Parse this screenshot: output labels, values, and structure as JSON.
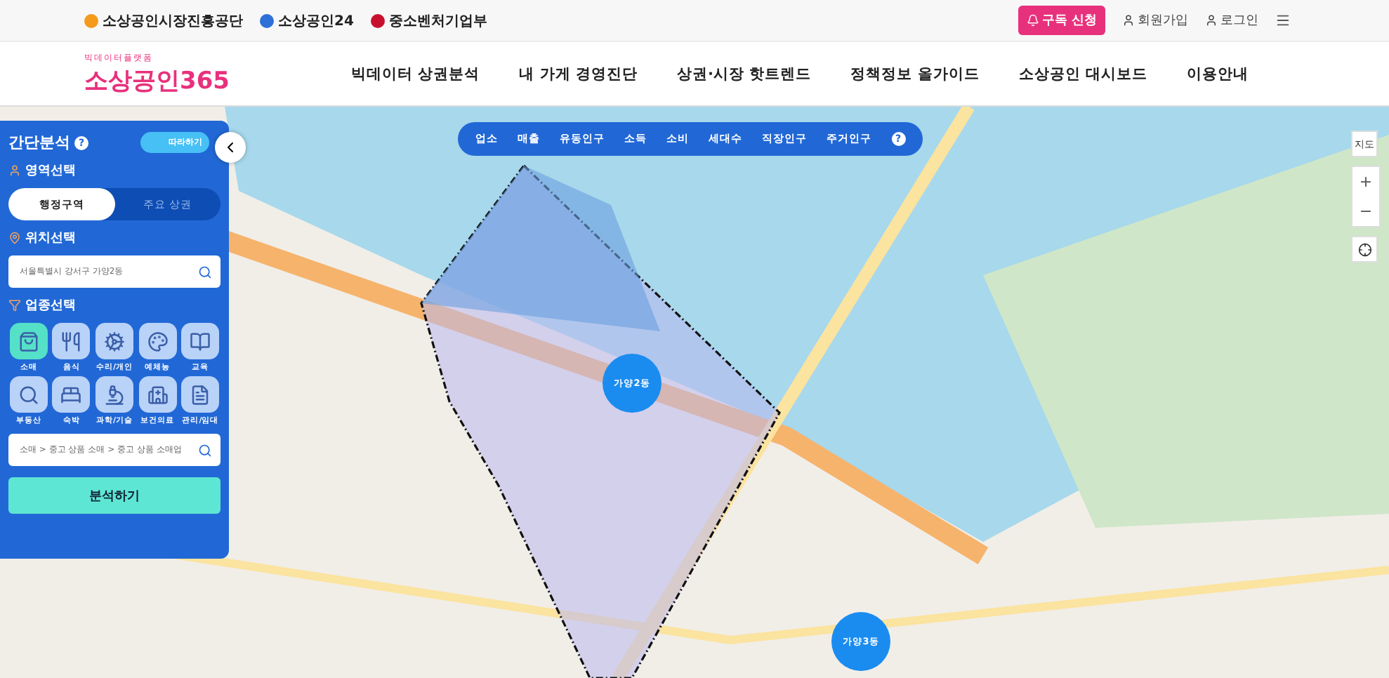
{
  "top_bar": {
    "agencies": [
      "소상공인시장진흥공단",
      "소상공인24",
      "중소벤처기업부"
    ],
    "subscribe_button": "구독 신청",
    "links": [
      "회원가입",
      "로그인"
    ]
  },
  "header": {
    "logo_tagline": "빅데이터플랫폼",
    "logo": "소상공인365",
    "nav": [
      "빅데이터 상권분석",
      "내 가게 경영진단",
      "상권·시장 핫트렌드",
      "정책정보 올가이드",
      "소상공인 대시보드",
      "이용안내"
    ]
  },
  "layer_tabs": {
    "items": [
      "업소",
      "매출",
      "유동인구",
      "소득",
      "소비",
      "세대수",
      "직장인구",
      "주거인구"
    ],
    "help": "?"
  },
  "map_controls": {
    "map_type": "지도",
    "zoom_in": "+",
    "zoom_out": "−"
  },
  "map_markers": [
    {
      "label": "가양2동",
      "kind": "big"
    },
    {
      "label": "가양3동",
      "kind": "big"
    }
  ],
  "panel": {
    "title": "간단분석",
    "help": "?",
    "guide_button": "따라하기",
    "area_section": {
      "title": "영역선택",
      "options": [
        {
          "label": "행정구역",
          "selected": true
        },
        {
          "label": "주요 상권",
          "selected": false
        }
      ]
    },
    "location_section": {
      "title": "위치선택",
      "value": "서울특별시 강서구 가양2동"
    },
    "industry_section": {
      "title": "업종선택",
      "items": [
        {
          "label": "소매",
          "selected": true
        },
        {
          "label": "음식",
          "selected": false
        },
        {
          "label": "수리/개인",
          "selected": false
        },
        {
          "label": "예체능",
          "selected": false
        },
        {
          "label": "교육",
          "selected": false
        },
        {
          "label": "부동산",
          "selected": false
        },
        {
          "label": "숙박",
          "selected": false
        },
        {
          "label": "과학/기술",
          "selected": false
        },
        {
          "label": "보건의료",
          "selected": false
        },
        {
          "label": "관리/임대",
          "selected": false
        }
      ],
      "value": "소매 > 중고 상품 소매 > 중고 상품 소매업"
    },
    "submit": "분석하기"
  }
}
